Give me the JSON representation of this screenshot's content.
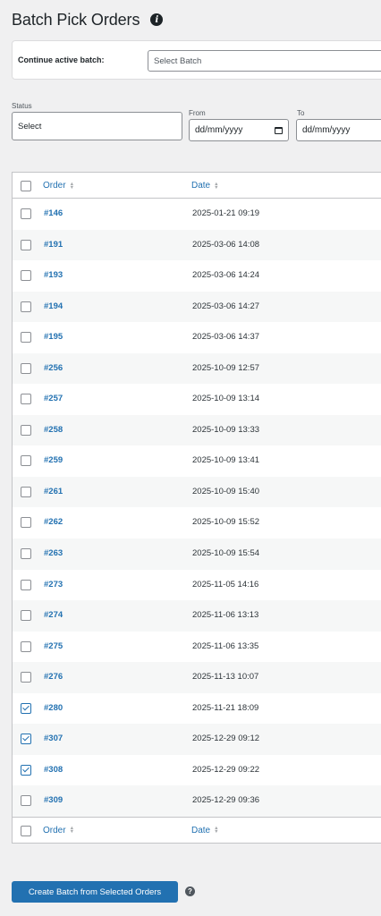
{
  "page": {
    "title": "Batch Pick Orders",
    "info_icon": "i"
  },
  "batch": {
    "label": "Continue active batch:",
    "placeholder": "Select Batch"
  },
  "filters": {
    "status_label": "Status",
    "status_value": "Select",
    "from_label": "From",
    "from_value": "dd/mm/yyyy",
    "to_label": "To",
    "to_value": "dd/mm/yyyy"
  },
  "table": {
    "header": {
      "order": "Order",
      "date": "Date"
    },
    "footer": {
      "order": "Order",
      "date": "Date"
    },
    "rows": [
      {
        "order": "#146",
        "date": "2025-01-21 09:19",
        "checked": false
      },
      {
        "order": "#191",
        "date": "2025-03-06 14:08",
        "checked": false
      },
      {
        "order": "#193",
        "date": "2025-03-06 14:24",
        "checked": false
      },
      {
        "order": "#194",
        "date": "2025-03-06 14:27",
        "checked": false
      },
      {
        "order": "#195",
        "date": "2025-03-06 14:37",
        "checked": false
      },
      {
        "order": "#256",
        "date": "2025-10-09 12:57",
        "checked": false
      },
      {
        "order": "#257",
        "date": "2025-10-09 13:14",
        "checked": false
      },
      {
        "order": "#258",
        "date": "2025-10-09 13:33",
        "checked": false
      },
      {
        "order": "#259",
        "date": "2025-10-09 13:41",
        "checked": false
      },
      {
        "order": "#261",
        "date": "2025-10-09 15:40",
        "checked": false
      },
      {
        "order": "#262",
        "date": "2025-10-09 15:52",
        "checked": false
      },
      {
        "order": "#263",
        "date": "2025-10-09 15:54",
        "checked": false
      },
      {
        "order": "#273",
        "date": "2025-11-05 14:16",
        "checked": false
      },
      {
        "order": "#274",
        "date": "2025-11-06 13:13",
        "checked": false
      },
      {
        "order": "#275",
        "date": "2025-11-06 13:35",
        "checked": false
      },
      {
        "order": "#276",
        "date": "2025-11-13 10:07",
        "checked": false
      },
      {
        "order": "#280",
        "date": "2025-11-21 18:09",
        "checked": true
      },
      {
        "order": "#307",
        "date": "2025-12-29 09:12",
        "checked": true
      },
      {
        "order": "#308",
        "date": "2025-12-29 09:22",
        "checked": true
      },
      {
        "order": "#309",
        "date": "2025-12-29 09:36",
        "checked": false
      }
    ]
  },
  "actions": {
    "create_label": "Create Batch from Selected Orders",
    "help_icon": "?"
  },
  "colors": {
    "accent": "#2271b1",
    "background": "#f0f0f1",
    "row_alt": "#f6f7f7"
  }
}
